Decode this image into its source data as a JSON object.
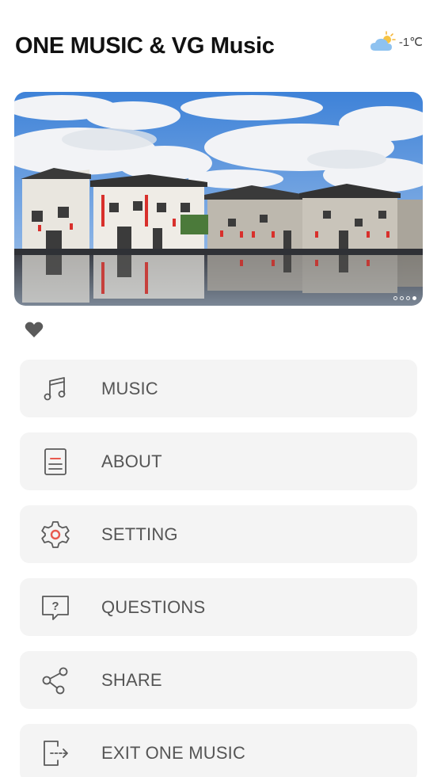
{
  "header": {
    "title": "ONE MUSIC & VG Music",
    "weather": {
      "icon": "partly-cloudy-icon",
      "temperature": "-1℃"
    }
  },
  "banner": {
    "image": "village-reflection-photo",
    "slide_count": 4,
    "active_slide": 4
  },
  "favorite": {
    "icon": "heart-icon"
  },
  "menu": {
    "items": [
      {
        "label": "MUSIC",
        "icon": "music-note-icon"
      },
      {
        "label": "ABOUT",
        "icon": "document-icon"
      },
      {
        "label": "SETTING",
        "icon": "gear-icon"
      },
      {
        "label": "QUESTIONS",
        "icon": "question-bubble-icon"
      },
      {
        "label": "SHARE",
        "icon": "share-icon"
      },
      {
        "label": "EXIT ONE MUSIC",
        "icon": "exit-icon"
      }
    ]
  },
  "colors": {
    "accent": "#e8594f",
    "card_bg": "#f4f4f4",
    "label": "#555555"
  }
}
